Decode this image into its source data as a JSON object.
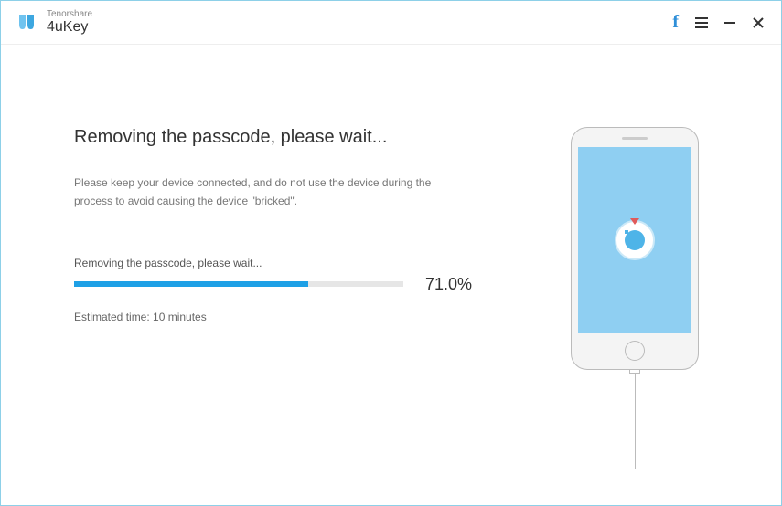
{
  "brand": {
    "company": "Tenorshare",
    "product": "4uKey"
  },
  "main": {
    "heading": "Removing the passcode, please wait...",
    "description": "Please keep your device connected, and do not use the device during the process to avoid causing the device \"bricked\".",
    "progress_label": "Removing the passcode, please wait...",
    "progress_percent_text": "71.0%",
    "progress_percent_value": 71.0,
    "eta": "Estimated time: 10 minutes"
  },
  "colors": {
    "accent": "#1ea0e6",
    "phone_screen": "#8fcff2"
  }
}
